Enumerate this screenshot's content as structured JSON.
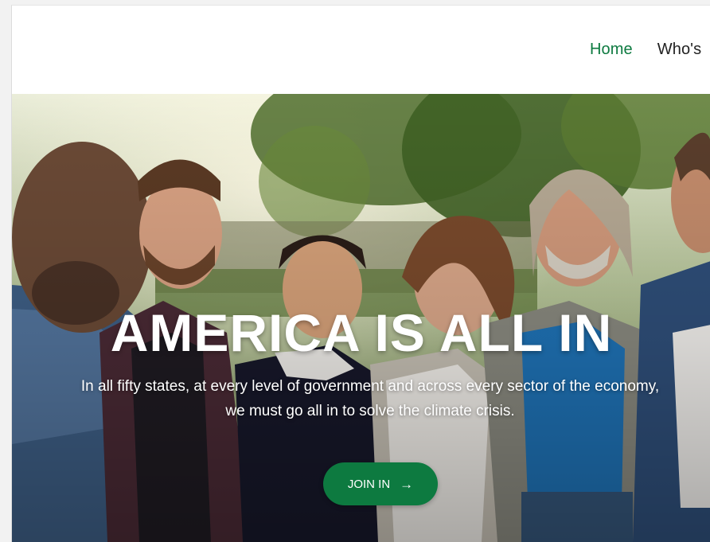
{
  "nav": {
    "items": [
      {
        "label": "Home",
        "active": true
      },
      {
        "label": "Who's"
      }
    ],
    "active_color": "#0d7a40"
  },
  "hero": {
    "title": "AMERICA IS ALL IN",
    "subtitle_line1": "In all fifty states, at every level of government and across every sector of the economy,",
    "subtitle_line2": "we must go all in to solve the climate crisis.",
    "cta_label": "JOIN IN",
    "cta_icon": "arrow-right-icon",
    "cta_color": "#0d7a40"
  }
}
